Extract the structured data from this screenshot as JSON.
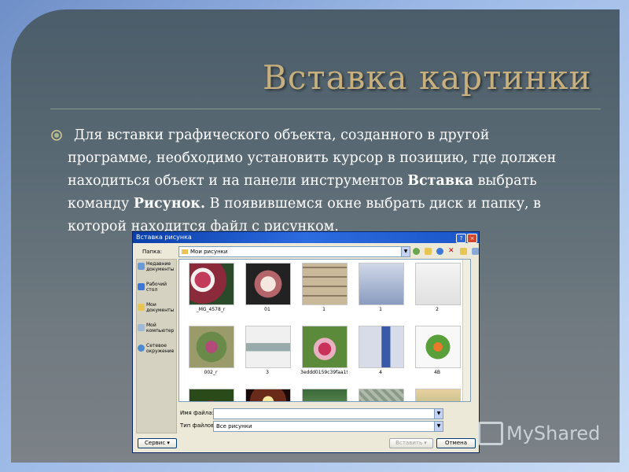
{
  "slide": {
    "title": "Вставка картинки",
    "paragraph_lines": [
      "Для вставки графического объекта, созданного в другой",
      "программе, необходимо установить курсор в позицию, где должен",
      "находиться объект и  на панели инструментов ",
      "команду ",
      " В  появившемся окне выбрать диск и папку, в",
      "которой находится файл с рисунком."
    ],
    "bold_insert": "Вставка",
    "line3_tail": " выбрать",
    "bold_picture": "Рисунок."
  },
  "dialog": {
    "title": "Вставка рисунка",
    "help_glyph": "?",
    "close_glyph": "×",
    "folder_label": "Папка:",
    "folder_value": "Мои рисунки",
    "places": [
      {
        "label": "Недавние документы",
        "icon": "recent-docs-icon"
      },
      {
        "label": "Рабочий стол",
        "icon": "desktop-icon"
      },
      {
        "label": "Мои документы",
        "icon": "my-documents-icon"
      },
      {
        "label": "Мой компьютер",
        "icon": "my-computer-icon"
      },
      {
        "label": "Сетевое окружение",
        "icon": "network-icon"
      }
    ],
    "files": [
      {
        "name": "_MG_4578_r"
      },
      {
        "name": "01"
      },
      {
        "name": "1"
      },
      {
        "name": "1"
      },
      {
        "name": "2"
      },
      {
        "name": "002_r"
      },
      {
        "name": "3"
      },
      {
        "name": "3eddd0159c39faa19..."
      },
      {
        "name": "4"
      },
      {
        "name": "4B"
      },
      {
        "name": ""
      },
      {
        "name": ""
      },
      {
        "name": ""
      },
      {
        "name": ""
      },
      {
        "name": ""
      }
    ],
    "filename_label": "Имя файла:",
    "filename_value": "",
    "filetype_label": "Тип файлов:",
    "filetype_value": "Все рисунки",
    "tools_button": "Сервис",
    "insert_button": "Вставить",
    "cancel_button": "Отмена"
  },
  "watermark": {
    "text_my": "My",
    "text_shared": "Shared"
  },
  "colors": {
    "title": "#c7b07e",
    "slide_bg": "#5a6a74",
    "dialog_bg": "#ece9d8",
    "titlebar": "#2c6be0"
  }
}
